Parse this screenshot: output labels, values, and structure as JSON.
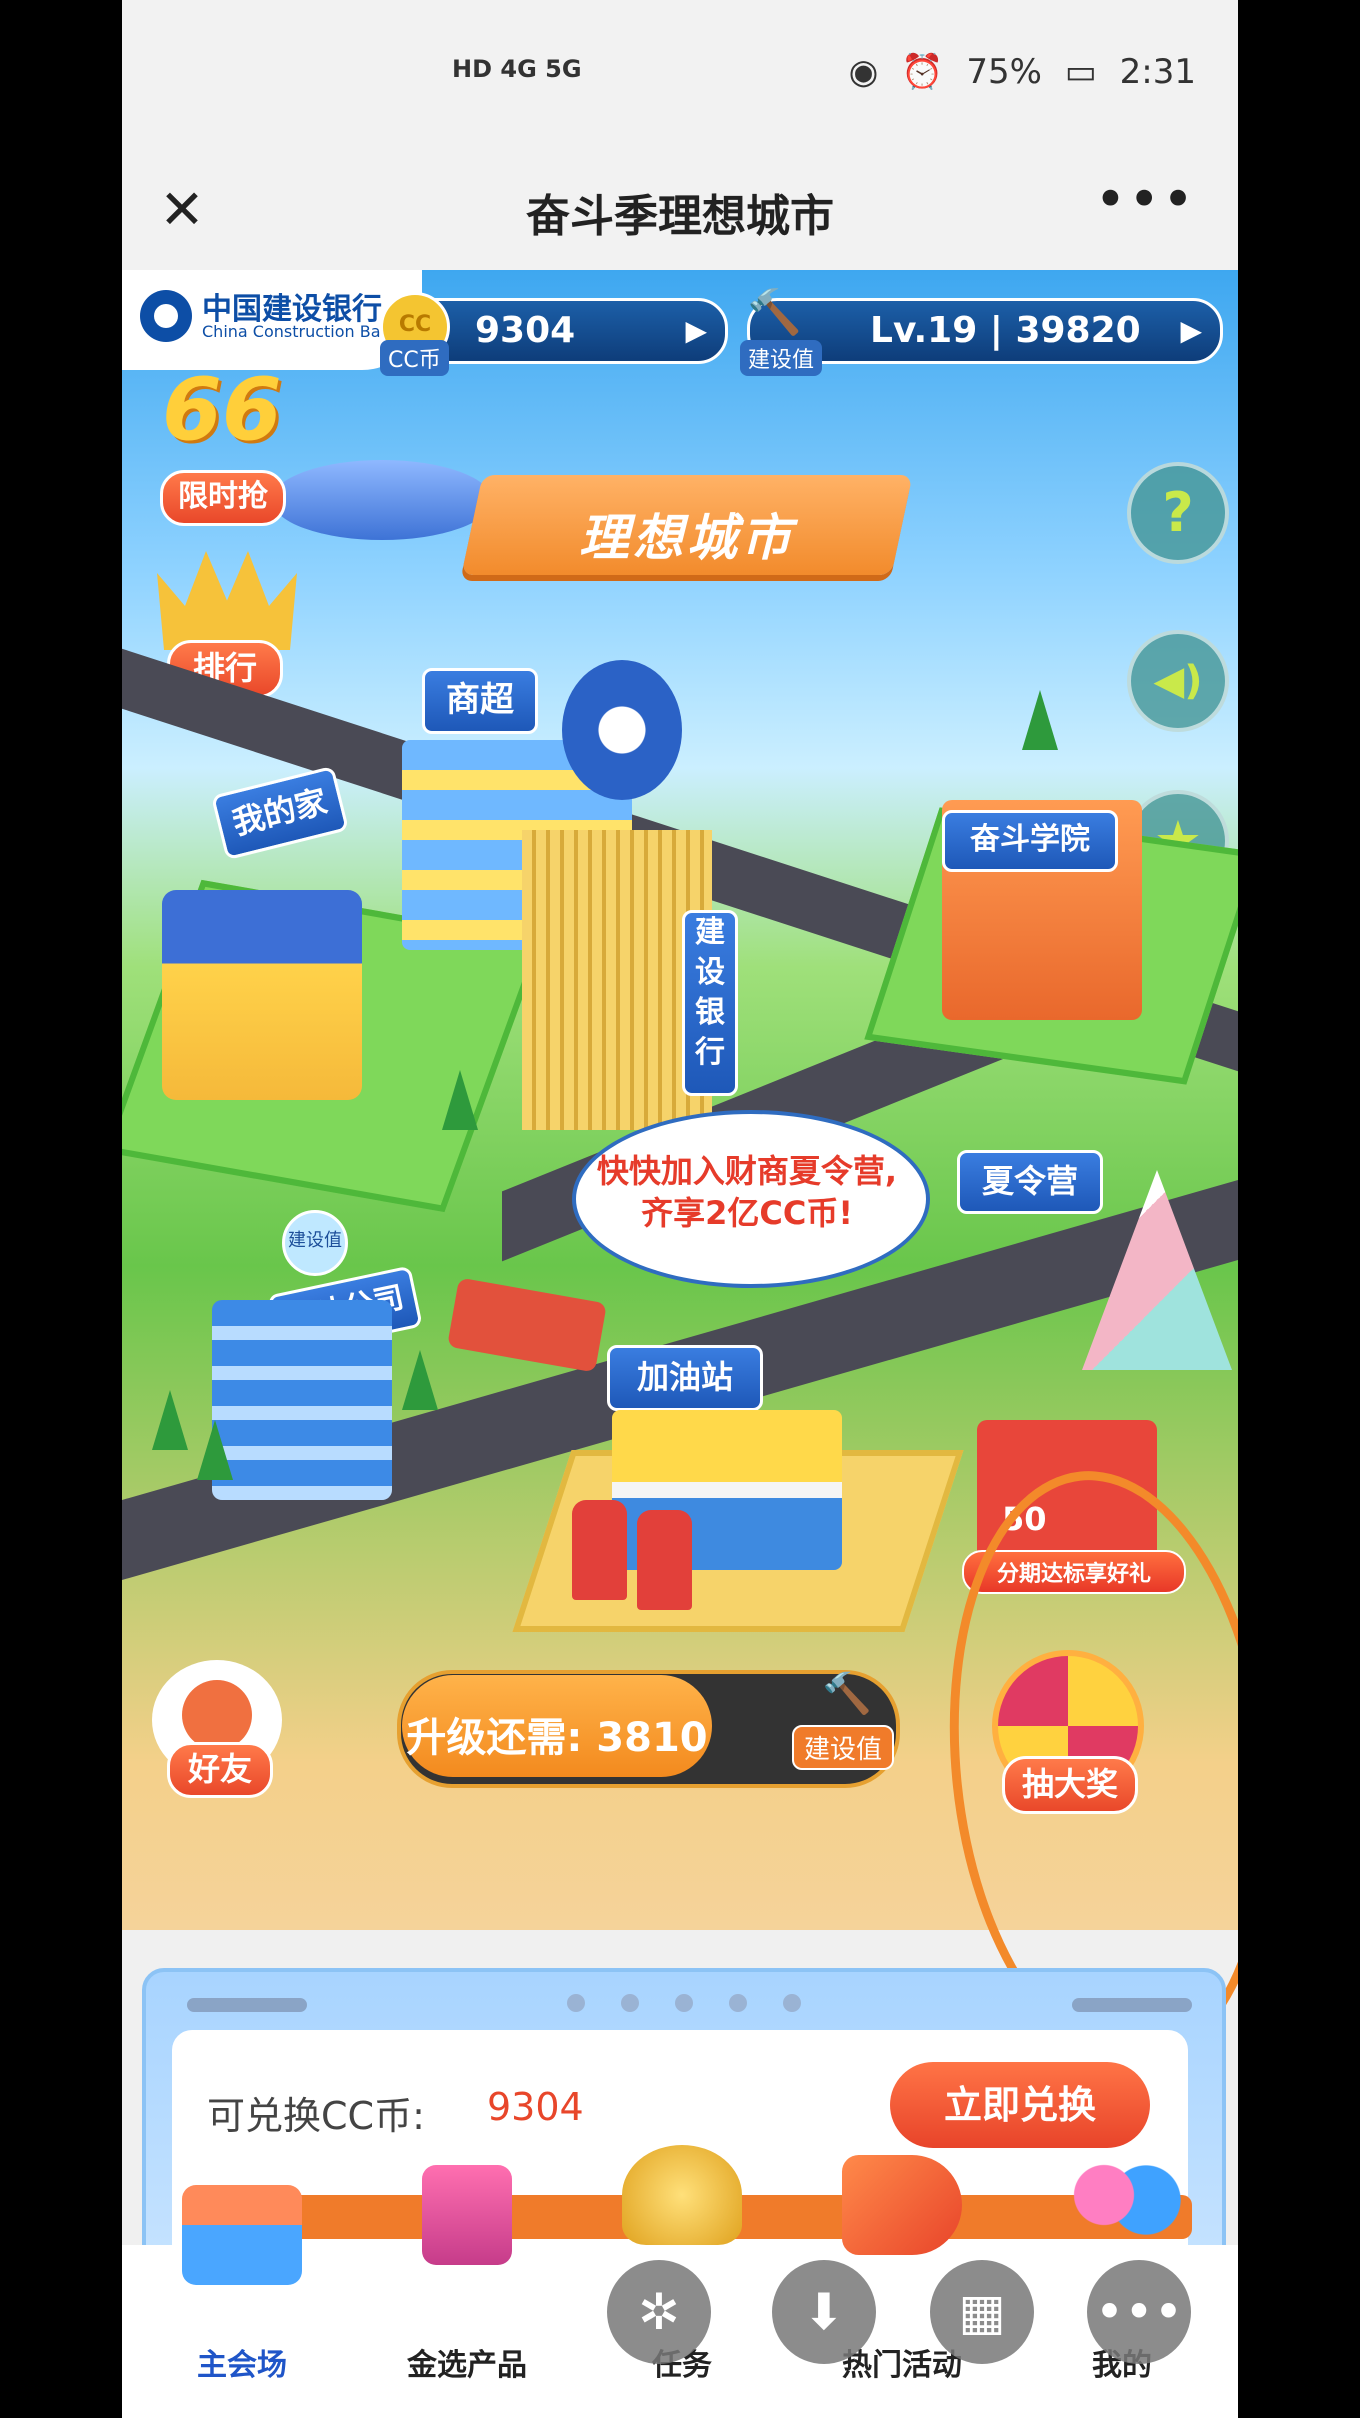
{
  "status_bar": {
    "signal_left": "HD 4G 5G",
    "battery": "75%",
    "time": "2:31"
  },
  "title_bar": {
    "title": "奋斗季理想城市",
    "close_symbol": "✕",
    "more_symbol": "•••"
  },
  "header": {
    "bank_name_cn": "中国建设银行",
    "bank_name_en": "China Construction Bank",
    "coin_icon_text": "CC",
    "coin_label": "CC币",
    "coin_value": "9304",
    "build_label": "建设值",
    "level_value": "Lv.19 | 39820"
  },
  "scene": {
    "banner": "理想城市",
    "promo_66": "66",
    "limited_sale": "限时抢",
    "rank": "排行",
    "question": "?",
    "buildings": {
      "supermarket": "商超",
      "my_home": "我的家",
      "academy": "奋斗学院",
      "bank": "建设银行",
      "company": "奋斗公司",
      "summer_camp": "夏令营",
      "gas_station": "加油站",
      "build_value_bubble": "建设值"
    },
    "speech_bubble_line1": "快快加入财商夏令营,",
    "speech_bubble_line2": "齐享2亿CC币!",
    "friends": "好友",
    "upgrade_text": "升级还需: 3810",
    "upgrade_tag": "建设值",
    "gift_label": "分期达标享好礼",
    "gift_amount": "50",
    "lottery": "抽大奖"
  },
  "exchange": {
    "label": "可兑换CC币:",
    "value": "9304",
    "button": "立即兑换"
  },
  "tabs": [
    {
      "label": "主会场",
      "icon": "shop-icon"
    },
    {
      "label": "金选产品",
      "icon": "gift-bag-icon"
    },
    {
      "label": "任务",
      "icon": "trophy-icon"
    },
    {
      "label": "热门活动",
      "icon": "megaphone-icon"
    },
    {
      "label": "我的",
      "icon": "user-icon"
    }
  ],
  "floating_buttons": [
    "pinwheel-icon",
    "download-icon",
    "grid-icon",
    "more-icon"
  ],
  "colors": {
    "accent_orange": "#f38a2a",
    "brand_blue": "#0d4ea6",
    "active_tab": "#1f55c8",
    "value_red": "#e8462a"
  }
}
